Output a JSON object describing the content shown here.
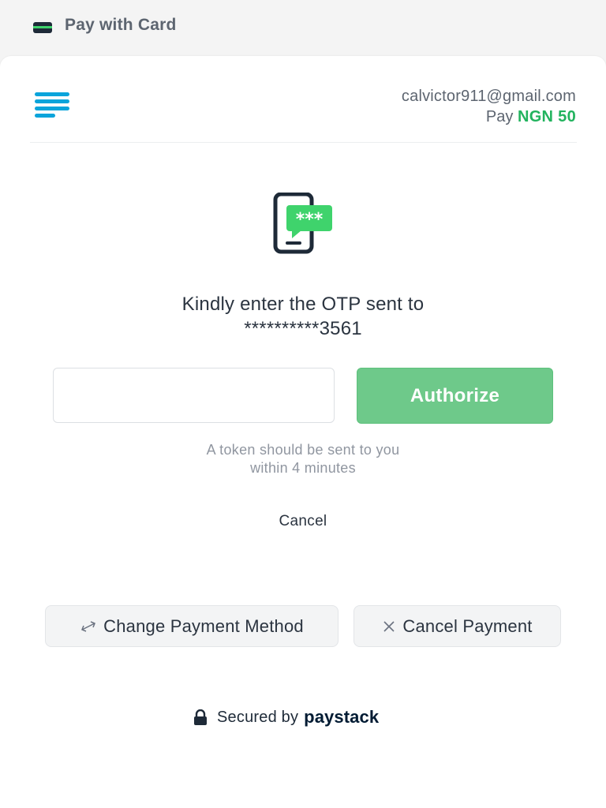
{
  "header": {
    "title": "Pay with Card",
    "icon": "credit-card-icon"
  },
  "merchant": {
    "logo_icon": "menu-lines-logo-icon",
    "email": "calvictor911@gmail.com",
    "pay_label": "Pay",
    "amount": "NGN 50"
  },
  "otp": {
    "icon": "phone-message-icon",
    "message_line1": "Kindly enter the OTP sent to",
    "message_line2": "**********3561",
    "input_value": "",
    "input_placeholder": "",
    "authorize_label": "Authorize",
    "hint_line1": "A token should be sent to you",
    "hint_line2": "within 4 minutes",
    "cancel_label": "Cancel"
  },
  "actions": {
    "change_payment_label": "Change Payment Method",
    "change_payment_icon": "swap-arrows-icon",
    "cancel_payment_label": "Cancel Payment",
    "cancel_payment_icon": "close-icon"
  },
  "footer": {
    "secured_label": "Secured by",
    "brand": "paystack",
    "icon": "lock-icon"
  },
  "colors": {
    "accent_green": "#22b35e",
    "button_green": "#6ec98a",
    "logo_blue": "#0ba4db",
    "dark_text": "#2b3440"
  }
}
